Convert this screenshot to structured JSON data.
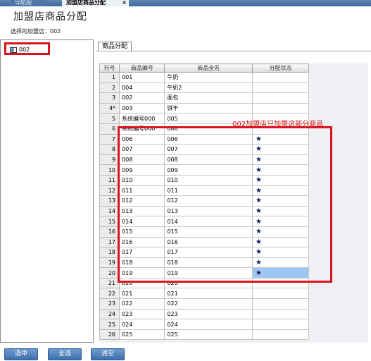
{
  "tabs": [
    {
      "label": "导航图"
    },
    {
      "label": "加盟店商品分配",
      "close": "×"
    }
  ],
  "page": {
    "title": "加盟店商品分配",
    "selected_store_label": "选择的加盟店：002"
  },
  "tree": {
    "item": "002"
  },
  "subtab": "商品分配",
  "grid": {
    "headers": [
      "行号",
      "商品编号",
      "商品全名",
      "分配状态"
    ],
    "rows": [
      [
        "1",
        "001",
        "牛奶",
        ""
      ],
      [
        "2",
        "004",
        "牛奶2",
        ""
      ],
      [
        "3",
        "002",
        "面包",
        ""
      ],
      [
        "4*",
        "003",
        "饼干",
        ""
      ],
      [
        "5",
        "系统编号000",
        "005",
        ""
      ],
      [
        "6",
        "系统编号000",
        "006",
        ""
      ],
      [
        "7",
        "006",
        "006",
        "★"
      ],
      [
        "8",
        "007",
        "007",
        "★"
      ],
      [
        "9",
        "008",
        "008",
        "★"
      ],
      [
        "10",
        "009",
        "009",
        "★"
      ],
      [
        "11",
        "010",
        "010",
        "★"
      ],
      [
        "12",
        "011",
        "011",
        "★"
      ],
      [
        "13",
        "012",
        "012",
        "★"
      ],
      [
        "14",
        "013",
        "013",
        "★"
      ],
      [
        "15",
        "014",
        "014",
        "★"
      ],
      [
        "16",
        "015",
        "015",
        "★"
      ],
      [
        "17",
        "016",
        "016",
        "★"
      ],
      [
        "18",
        "017",
        "017",
        "★"
      ],
      [
        "19",
        "018",
        "018",
        "★"
      ],
      [
        "20",
        "019",
        "019",
        "★"
      ],
      [
        "21",
        "020",
        "020",
        ""
      ],
      [
        "22",
        "021",
        "021",
        ""
      ],
      [
        "23",
        "022",
        "022",
        ""
      ],
      [
        "24",
        "023",
        "023",
        ""
      ],
      [
        "25",
        "024",
        "024",
        ""
      ],
      [
        "26",
        "025",
        "025",
        ""
      ]
    ]
  },
  "annotation": "002加盟店只加盟这部分商品",
  "buttons": {
    "select": "选中",
    "select_all": "全选",
    "clear": "清空"
  },
  "colors": {
    "annotation_red": "#d9141c",
    "selected_cell": "#9ec6f2",
    "button_blue": "#4a7dbb"
  }
}
